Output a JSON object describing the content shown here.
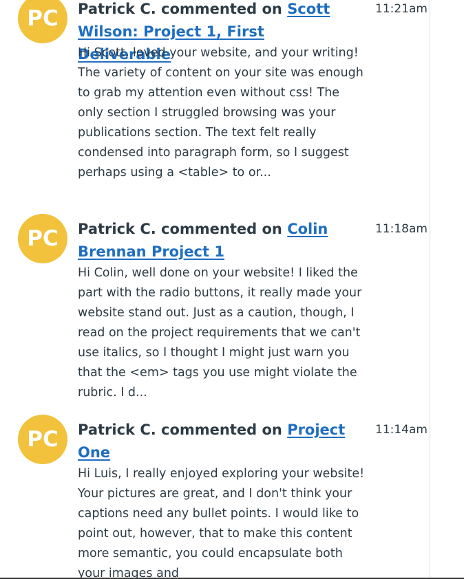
{
  "feed": {
    "items": [
      {
        "avatar_initials": "PC",
        "author": "Patrick C.",
        "verb": "commented on",
        "link": "Scott Wilson: Project 1, First Deliverable",
        "time": "11:21am",
        "body": "Hi Scott, loved your website, and your writing! The variety of content on your site was enough to grab my attention even without css! The only section I struggled browsing was your publications section. The text felt really condensed into paragraph form, so I suggest perhaps using a <table> to or..."
      },
      {
        "avatar_initials": "PC",
        "author": "Patrick C.",
        "verb": "commented on",
        "link": "Colin Brennan Project 1",
        "time": "11:18am",
        "body": "Hi Colin, well done on your website! I liked the part with the radio buttons, it really made your website stand out. Just as a caution, though, I read on the project requirements that we can't use italics, so I thought I might just warn you that the <em> tags you use might violate the rubric. I d..."
      },
      {
        "avatar_initials": "PC",
        "author": "Patrick C.",
        "verb": "commented on",
        "link": "Project One",
        "time": "11:14am",
        "body": "Hi Luis, I really enjoyed exploring your website! Your pictures are great, and I don't think your captions need any bullet points. I would like to point out, however, that to make this content more semantic, you could encapsulate both your images and"
      }
    ]
  },
  "colors": {
    "avatar": "#f2c23c",
    "link": "#1f6ec0",
    "text": "#2d3b45"
  }
}
